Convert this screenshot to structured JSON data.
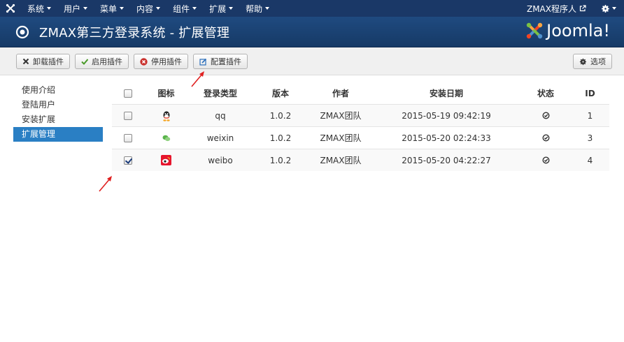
{
  "topnav": {
    "menu": [
      "系统",
      "用户",
      "菜单",
      "内容",
      "组件",
      "扩展",
      "帮助"
    ],
    "user": "ZMAX程序人"
  },
  "header": {
    "title": "ZMAX第三方登录系统 - 扩展管理",
    "logo_text": "Joomla!"
  },
  "toolbar": {
    "uninstall": "卸载插件",
    "enable": "启用插件",
    "disable": "停用插件",
    "configure": "配置插件",
    "options": "选项"
  },
  "sidebar": {
    "items": [
      "使用介绍",
      "登陆用户",
      "安装扩展",
      "扩展管理"
    ],
    "active_index": 3
  },
  "table": {
    "headers": {
      "icon": "图标",
      "type": "登录类型",
      "version": "版本",
      "author": "作者",
      "date": "安装日期",
      "status": "状态",
      "id": "ID"
    },
    "rows": [
      {
        "icon": "qq-icon",
        "type": "qq",
        "version": "1.0.2",
        "author": "ZMAX团队",
        "date": "2015-05-19 09:42:19",
        "id": "1",
        "checked": false
      },
      {
        "icon": "weixin-icon",
        "type": "weixin",
        "version": "1.0.2",
        "author": "ZMAX团队",
        "date": "2015-05-20 02:24:33",
        "id": "3",
        "checked": false
      },
      {
        "icon": "weibo-icon",
        "type": "weibo",
        "version": "1.0.2",
        "author": "ZMAX团队",
        "date": "2015-05-20 04:22:27",
        "id": "4",
        "checked": true
      }
    ]
  },
  "colors": {
    "topnav": "#1a3867",
    "header": "#1c4476",
    "sidebar_active": "#2a7fc4",
    "annotation_arrow": "#e02020"
  }
}
